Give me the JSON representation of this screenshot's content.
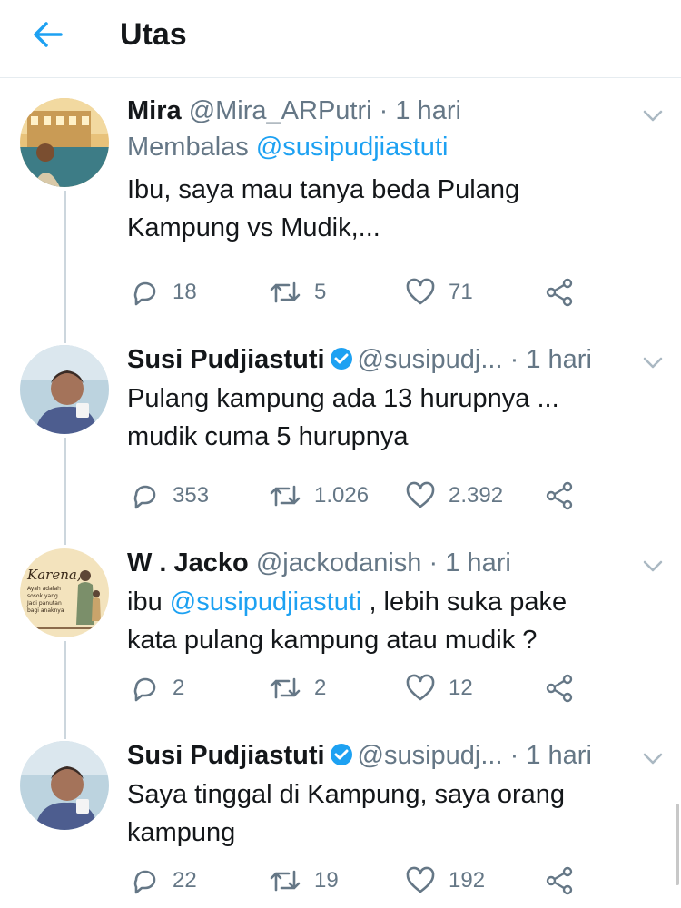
{
  "header": {
    "title": "Utas"
  },
  "tweets": [
    {
      "name": "Mira",
      "handle": "@Mira_ARPutri",
      "dot": "·",
      "time": "1 hari",
      "reply_prefix": "Membalas",
      "reply_handle": "@susipudjiastuti",
      "text_lines": [
        "Ibu, saya mau tanya beda Pulang",
        "Kampung vs Mudik,..."
      ],
      "replies": "18",
      "retweets": "5",
      "likes": "71"
    },
    {
      "name": "Susi Pudjiastuti",
      "handle": "@susipudj...",
      "dot": "·",
      "time": "1 hari",
      "text_lines": [
        "Pulang kampung ada 13 hurupnya ...",
        "mudik cuma 5 hurupnya"
      ],
      "replies": "353",
      "retweets": "1.026",
      "likes": "2.392"
    },
    {
      "name": "W . Jacko",
      "handle": "@jackodanish",
      "dot": "·",
      "time": "1 hari",
      "text_prefix": "ibu",
      "text_mention": "@susipudjiastuti",
      "text_suffix": ", lebih suka pake",
      "text_line2": "kata pulang kampung atau mudik ?",
      "replies": "2",
      "retweets": "2",
      "likes": "12"
    },
    {
      "name": "Susi Pudjiastuti",
      "handle": "@susipudj...",
      "dot": "·",
      "time": "1 hari",
      "text_lines": [
        "Saya tinggal di Kampung, saya orang",
        "kampung"
      ],
      "replies": "22",
      "retweets": "19",
      "likes": "192"
    }
  ],
  "avatar_art": {
    "jacko": {
      "title": "Karena,",
      "lines": [
        "Ayah adalah",
        "sosok yang ...",
        "Jadi panutan",
        "bagi anaknya"
      ]
    }
  },
  "colors": {
    "accent": "#1da1f2",
    "verified": "#1da1f2",
    "secondary_text": "#657786",
    "thread_line": "#ccd6dd"
  },
  "icons": [
    "back-arrow-icon",
    "chevron-down-icon",
    "verified-badge-icon",
    "reply-icon",
    "retweet-icon",
    "like-icon",
    "share-icon"
  ]
}
